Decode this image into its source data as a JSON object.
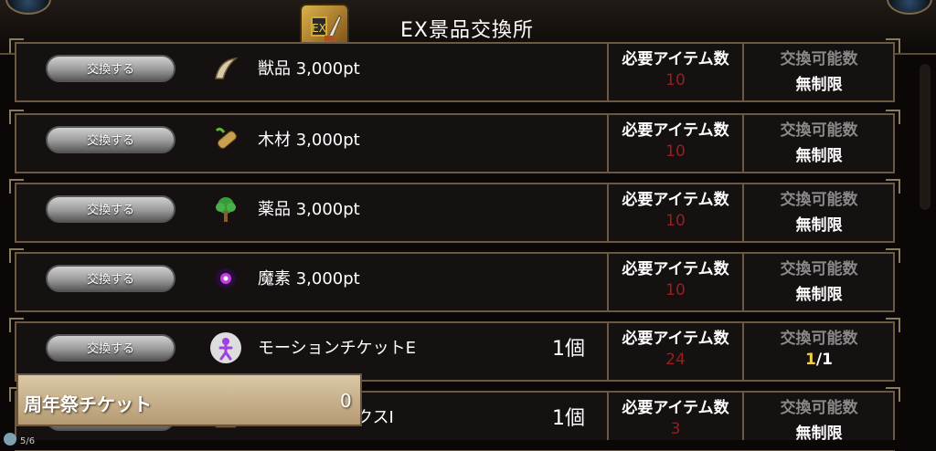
{
  "header": {
    "title": "EX景品交換所"
  },
  "button_label": "交換する",
  "required_label": "必要アイテム数",
  "available_label": "交換可能数",
  "rows": [
    {
      "name": "獣品 3,000pt",
      "qty": "",
      "required": "10",
      "available": "無制限",
      "icon": "fang-icon"
    },
    {
      "name": "木材 3,000pt",
      "qty": "",
      "required": "10",
      "available": "無制限",
      "icon": "wood-icon"
    },
    {
      "name": "薬品 3,000pt",
      "qty": "",
      "required": "10",
      "available": "無制限",
      "icon": "herb-icon"
    },
    {
      "name": "魔素 3,000pt",
      "qty": "",
      "required": "10",
      "available": "無制限",
      "icon": "magic-orb-icon"
    },
    {
      "name": "モーションチケットE",
      "qty": "1個",
      "required": "24",
      "available_current": "1",
      "available_total": "/1",
      "icon": "motion-ticket-icon"
    },
    {
      "name": "周年装備ボックスⅠ",
      "qty": "1個",
      "required": "3",
      "available": "無制限",
      "icon": "box-icon"
    }
  ],
  "ticket": {
    "label": "周年祭チケット",
    "value": "0"
  },
  "footer_text": "5/6",
  "colors": {
    "accent_red": "#9c1d1d",
    "highlight_yellow": "#f0d040",
    "frame": "#6a5a44"
  }
}
